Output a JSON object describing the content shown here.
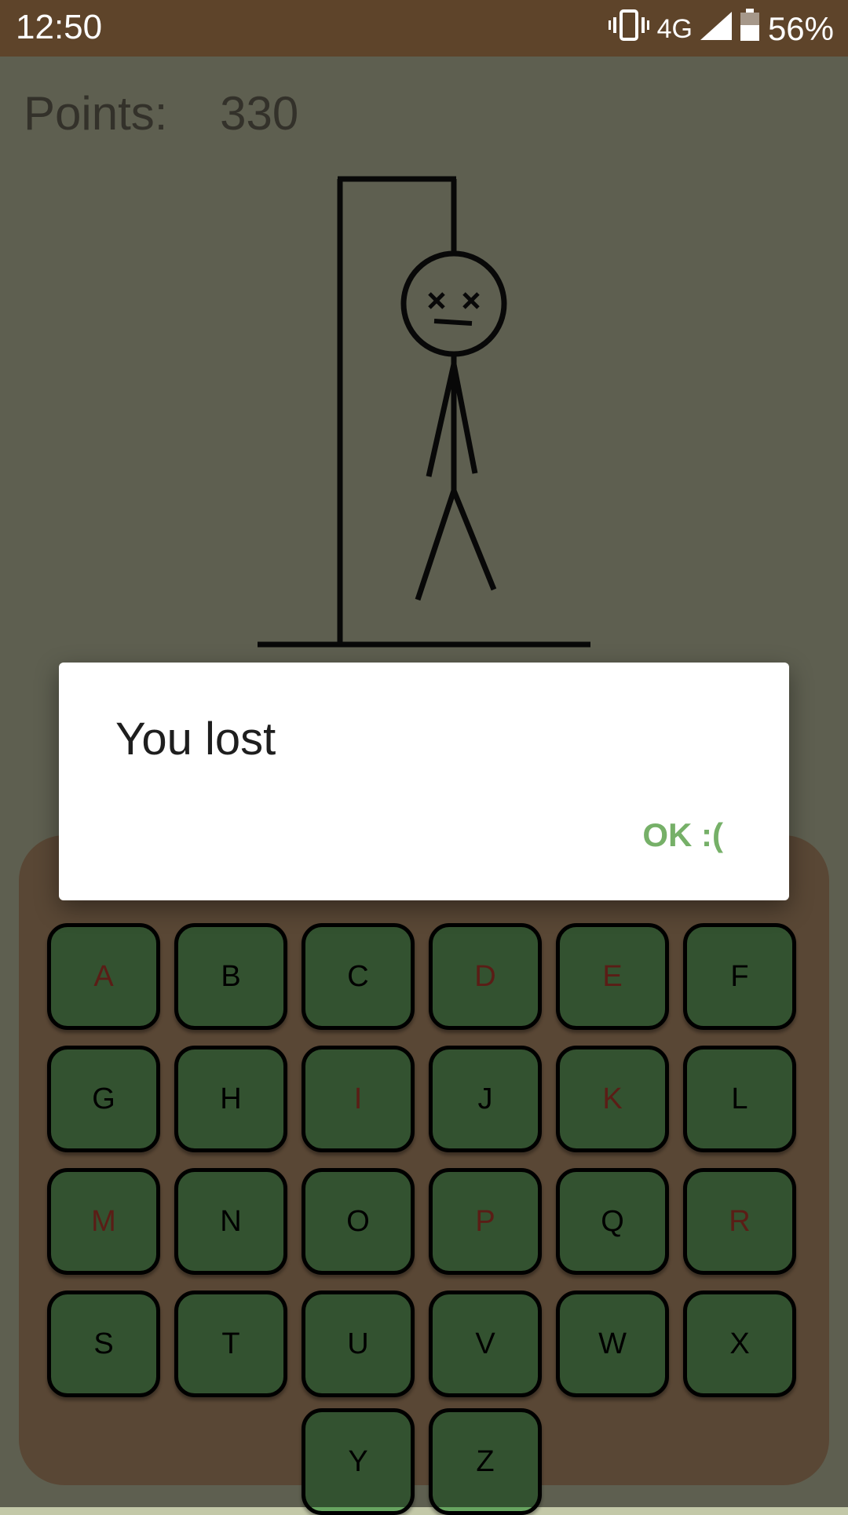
{
  "status_bar": {
    "time": "12:50",
    "network": "4G",
    "battery": "56%",
    "icons": [
      "vibrate-icon",
      "signal-icon",
      "battery-icon"
    ]
  },
  "game": {
    "points_label": "Points:",
    "points_value": "330"
  },
  "keyboard": {
    "keys": [
      {
        "letter": "A",
        "used": true
      },
      {
        "letter": "B",
        "used": false
      },
      {
        "letter": "C",
        "used": false
      },
      {
        "letter": "D",
        "used": true
      },
      {
        "letter": "E",
        "used": true
      },
      {
        "letter": "F",
        "used": false
      },
      {
        "letter": "G",
        "used": false
      },
      {
        "letter": "H",
        "used": false
      },
      {
        "letter": "I",
        "used": true
      },
      {
        "letter": "J",
        "used": false
      },
      {
        "letter": "K",
        "used": true
      },
      {
        "letter": "L",
        "used": false
      },
      {
        "letter": "M",
        "used": true
      },
      {
        "letter": "N",
        "used": false
      },
      {
        "letter": "O",
        "used": false
      },
      {
        "letter": "P",
        "used": true
      },
      {
        "letter": "Q",
        "used": false
      },
      {
        "letter": "R",
        "used": true
      },
      {
        "letter": "S",
        "used": false
      },
      {
        "letter": "T",
        "used": false
      },
      {
        "letter": "U",
        "used": false
      },
      {
        "letter": "V",
        "used": false
      },
      {
        "letter": "W",
        "used": false
      },
      {
        "letter": "X",
        "used": false
      },
      {
        "letter": "Y",
        "used": false
      },
      {
        "letter": "Z",
        "used": false
      }
    ]
  },
  "dialog": {
    "title": "You lost",
    "ok_label": "OK :("
  },
  "colors": {
    "status_bar": "#5e442a",
    "background": "#bdbfa0",
    "keyboard_panel": "#b38e6a",
    "key_fill": "#67a460",
    "used_letter": "#b53a2c",
    "ok_text": "#76b068"
  }
}
